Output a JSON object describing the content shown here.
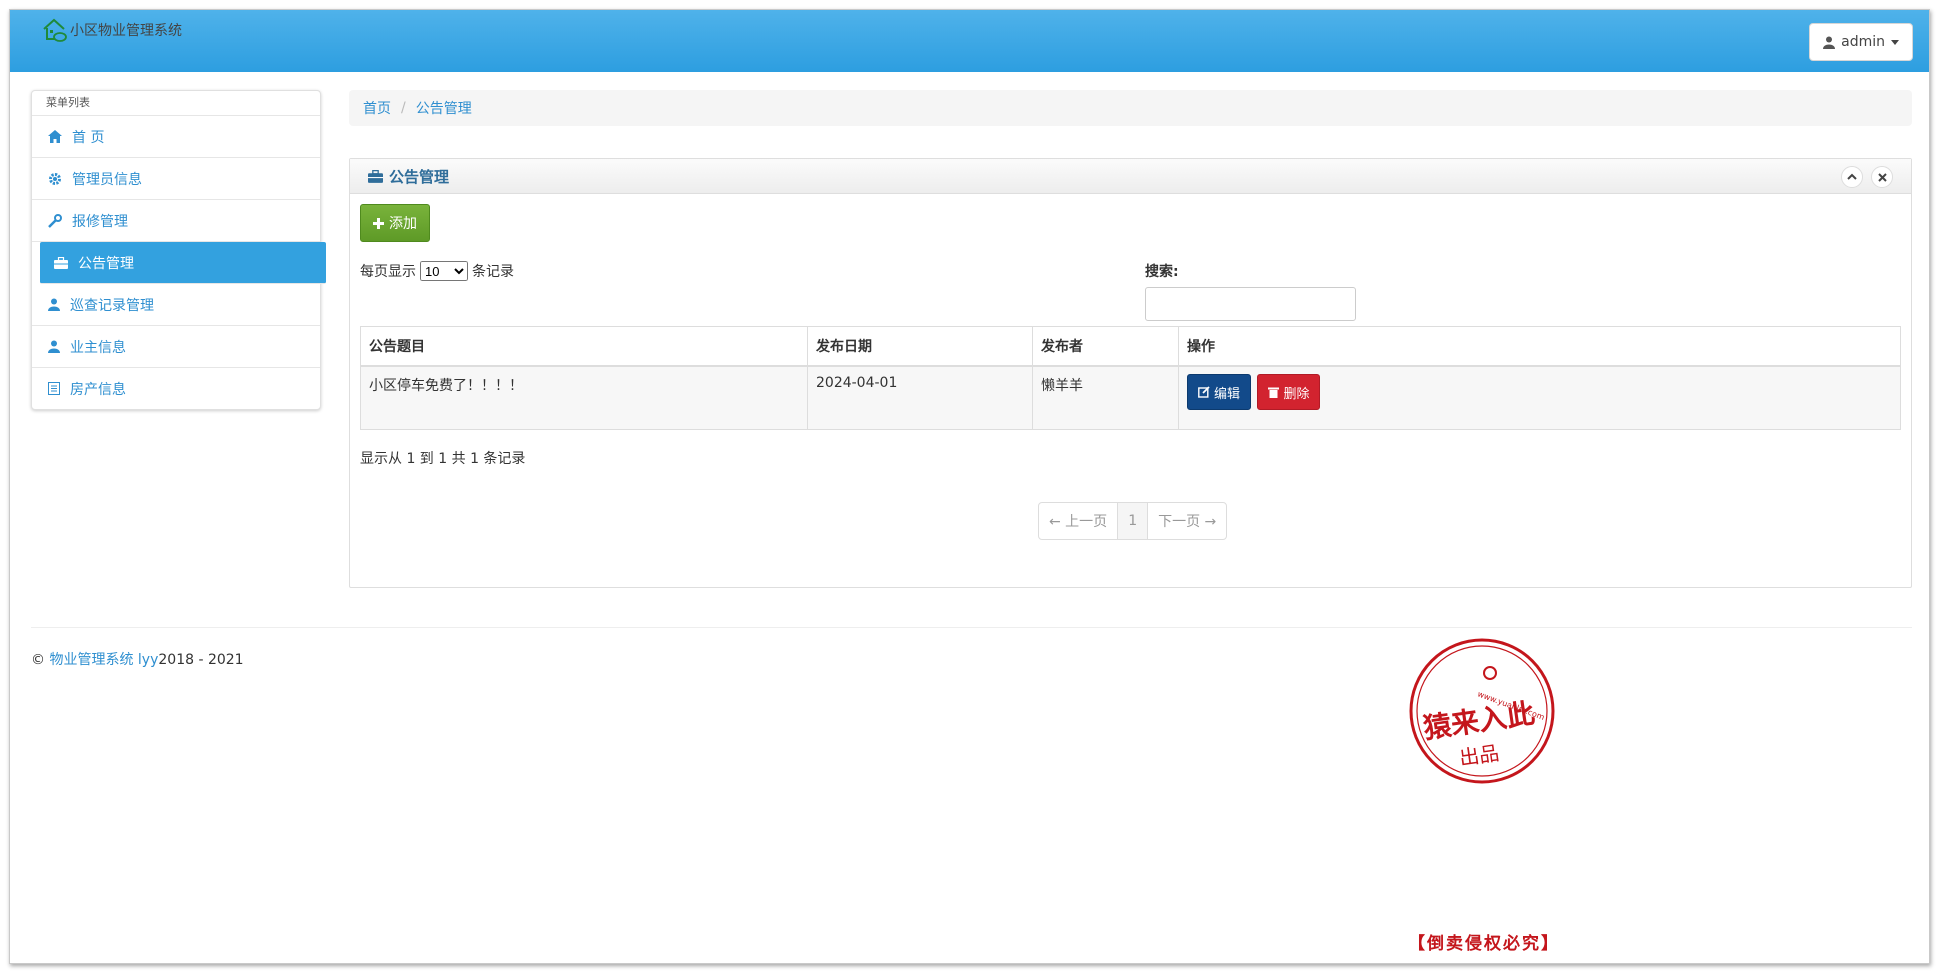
{
  "app": {
    "title": "小区物业管理系统"
  },
  "user": {
    "name": "admin"
  },
  "sidebar": {
    "heading": "菜单列表",
    "items": [
      {
        "label": "首 页",
        "icon": "home-icon"
      },
      {
        "label": "管理员信息",
        "icon": "gear-icon"
      },
      {
        "label": "报修管理",
        "icon": "wrench-icon"
      },
      {
        "label": "公告管理",
        "icon": "briefcase-icon",
        "active": true
      },
      {
        "label": "巡查记录管理",
        "icon": "user-icon"
      },
      {
        "label": "业主信息",
        "icon": "user-icon"
      },
      {
        "label": "房产信息",
        "icon": "list-icon"
      }
    ]
  },
  "breadcrumb": {
    "home": "首页",
    "current": "公告管理"
  },
  "panel": {
    "title": "公告管理",
    "add_label": "添加",
    "length_prefix": "每页显示",
    "length_value": "10",
    "length_suffix": "条记录",
    "search_label": "搜索:",
    "search_value": ""
  },
  "table": {
    "columns": [
      "公告题目",
      "发布日期",
      "发布者",
      "操作"
    ],
    "rows": [
      {
        "title": "小区停车免费了！！！！",
        "date": "2024-04-01",
        "author": "懒羊羊"
      }
    ],
    "edit_label": "编辑",
    "delete_label": "删除"
  },
  "info_text": "显示从 1 到 1 共 1 条记录",
  "pager": {
    "prev": "← 上一页",
    "current": "1",
    "next": "下一页 →"
  },
  "footer": {
    "prefix": "©",
    "link": "物业管理系统 lyy",
    "years": "2018 - 2021"
  },
  "watermark": {
    "url": "www.yuanlrc.com",
    "line1": "猿来入此",
    "line2": "出品",
    "note": "【倒卖侵权必究】",
    "color": "#c4161c"
  },
  "colors": {
    "header": "#36a3e3",
    "active": "#33a1df",
    "link": "#2f8fd0",
    "add": "#6aa52f",
    "edit": "#124a8a",
    "delete": "#d2232f"
  }
}
